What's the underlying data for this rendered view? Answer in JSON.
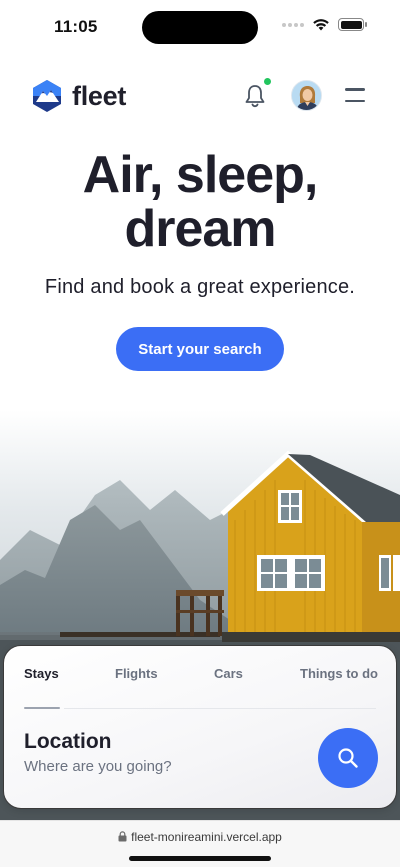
{
  "status_bar": {
    "time": "11:05",
    "icons": [
      "signal-dots-icon",
      "wifi-icon",
      "battery-icon"
    ]
  },
  "header": {
    "brand_name": "fleet",
    "logo_icon": "mountain-hexagon-logo",
    "notification_icon": "bell-icon",
    "notification_indicator_color": "#22c55e",
    "avatar_icon": "user-avatar",
    "menu_icon": "hamburger-menu-icon"
  },
  "hero": {
    "title_line1": "Air, sleep,",
    "title_line2": "dream",
    "subtitle": "Find and book a great experience.",
    "cta_label": "Start your search"
  },
  "search": {
    "tabs": [
      {
        "label": "Stays",
        "active": true
      },
      {
        "label": "Flights",
        "active": false
      },
      {
        "label": "Cars",
        "active": false
      },
      {
        "label": "Things to do",
        "active": false
      }
    ],
    "field_label": "Location",
    "field_placeholder": "Where are you going?",
    "button_icon": "search-icon"
  },
  "browser": {
    "url": "fleet-monireamini.vercel.app",
    "url_icon": "lock-icon"
  },
  "colors": {
    "accent": "#3b6ef5",
    "text": "#1f1f2b",
    "muted": "#6b7280",
    "house": "#d9a21b"
  }
}
